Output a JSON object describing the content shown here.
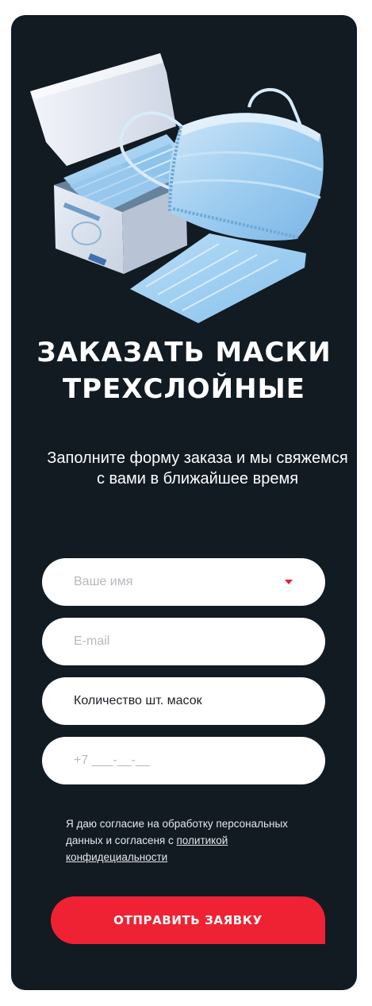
{
  "hero": {
    "image_name": "medical-masks-product-photo"
  },
  "title": {
    "line1": "ЗАКАЗАТЬ МАСКИ",
    "line2": "ТРЕХСЛОЙНЫЕ"
  },
  "subtitle": "Заполните форму заказа и мы свяжемся с вами в ближайшее время",
  "form": {
    "name_placeholder": "Ваше имя",
    "email_placeholder": "E-mail",
    "quantity_value": "Количество шт. масок",
    "phone_placeholder": "+7 ___-__-__"
  },
  "consent": {
    "text": "Я даю согласие на обработку персональных данных и согласеня с ",
    "link": "политикой конфидециальности"
  },
  "submit_label": "ОТПРАВИТЬ ЗАЯВКУ",
  "colors": {
    "background": "#121a22",
    "accent": "#ef2234",
    "field": "#ffffff"
  }
}
